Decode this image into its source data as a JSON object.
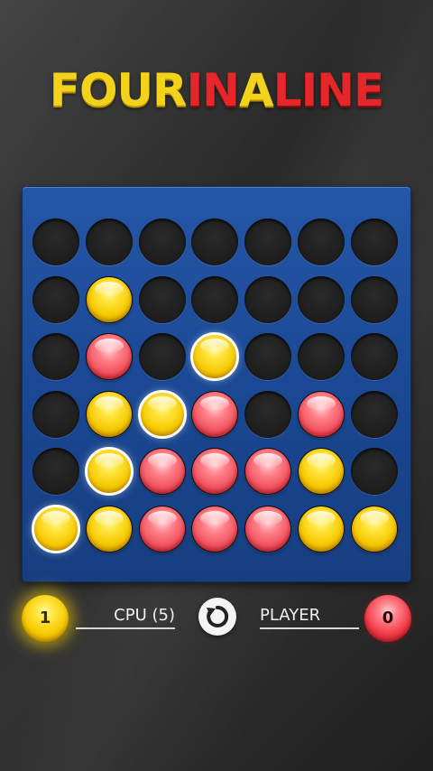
{
  "logo": {
    "w1": "FOUR",
    "w2": "IN",
    "w3": "A",
    "w4": "LINE"
  },
  "board": {
    "columns": 7,
    "rows": 6,
    "grid": [
      [
        null,
        null,
        null,
        null,
        null,
        null,
        null
      ],
      [
        null,
        "yellow",
        null,
        null,
        null,
        null,
        null
      ],
      [
        null,
        "red",
        null,
        "yellow",
        null,
        null,
        null
      ],
      [
        null,
        "yellow",
        "yellow",
        "red",
        null,
        "red",
        null
      ],
      [
        null,
        "yellow",
        "red",
        "red",
        "red",
        "yellow",
        null
      ],
      [
        "yellow",
        "yellow",
        "red",
        "red",
        "red",
        "yellow",
        "yellow"
      ]
    ],
    "winning_cells": [
      [
        2,
        3
      ],
      [
        3,
        2
      ],
      [
        4,
        1
      ],
      [
        5,
        0
      ]
    ]
  },
  "hud": {
    "cpu_score": "1",
    "cpu_label": "CPU (5)",
    "player_label": "PLAYER",
    "player_score": "0",
    "restart_icon": "restart-icon"
  },
  "colors": {
    "yellow": "#f6c800",
    "red": "#f0505c",
    "board": "#1a4894"
  }
}
